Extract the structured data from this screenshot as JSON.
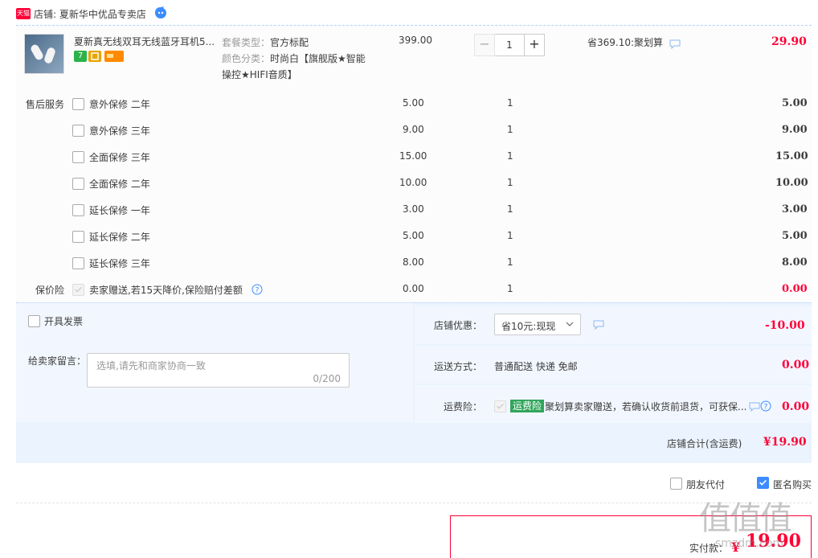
{
  "store": {
    "brand_badge": "天猫",
    "label": "店铺: 夏新华中优品专卖店"
  },
  "item": {
    "title": "夏新真无线双耳无线蓝牙耳机5...",
    "sku_package_label": "套餐类型：",
    "sku_package_value": "官方标配",
    "sku_color_label": "颜色分类：",
    "sku_color_value": "时尚白【旗舰版★智能",
    "sku_color_value2": "操控★HIFI音质】",
    "unit_price": "399.00",
    "quantity": "1",
    "minus": "−",
    "plus": "+",
    "discount": "省369.10:聚划算",
    "subtotal": "29.90",
    "badge_seven": "7"
  },
  "services": {
    "section_label": "售后服务",
    "items": [
      {
        "name": "意外保修 二年",
        "price": "5.00",
        "qty": "1",
        "total": "5.00"
      },
      {
        "name": "意外保修 三年",
        "price": "9.00",
        "qty": "1",
        "total": "9.00"
      },
      {
        "name": "全面保修 三年",
        "price": "15.00",
        "qty": "1",
        "total": "15.00"
      },
      {
        "name": "全面保修 二年",
        "price": "10.00",
        "qty": "1",
        "total": "10.00"
      },
      {
        "name": "延长保修 一年",
        "price": "3.00",
        "qty": "1",
        "total": "3.00"
      },
      {
        "name": "延长保修 二年",
        "price": "5.00",
        "qty": "1",
        "total": "5.00"
      },
      {
        "name": "延长保修 三年",
        "price": "8.00",
        "qty": "1",
        "total": "8.00"
      }
    ],
    "price_protect_label": "保价险",
    "price_protect_text": "卖家赠送,若15天降价,保险赔付差额",
    "price_protect_price": "0.00",
    "price_protect_qty": "1",
    "price_protect_total": "0.00"
  },
  "invoice": {
    "label": "开具发票"
  },
  "memo": {
    "label": "给卖家留言：",
    "placeholder": "选填,请先和商家协商一致",
    "counter": "0/200"
  },
  "coupon": {
    "label": "店铺优惠：",
    "selected": "省10元:现现",
    "amount": "-10.00"
  },
  "shipping": {
    "label": "运送方式：",
    "value": "普通配送 快递 免邮",
    "amount": "0.00"
  },
  "freight_ins": {
    "label": "运费险：",
    "badge": "运费险",
    "text": "聚划算卖家赠送，若确认收货前退货，可获保...",
    "amount": "0.00"
  },
  "store_total": {
    "label": "店铺合计(含运费)",
    "amount": "¥19.90"
  },
  "options": {
    "friend_pay": "朋友代付",
    "anonymous": "匿名购买"
  },
  "final": {
    "label": "实付款：",
    "amount": "19.90",
    "currency": "¥"
  },
  "watermark": {
    "glyphs": "值值值",
    "site": "smzdm.com"
  },
  "colors": {
    "accent_red": "#ff0036",
    "link_blue": "#3c8cff",
    "panel_blue": "#eaf3fe"
  }
}
